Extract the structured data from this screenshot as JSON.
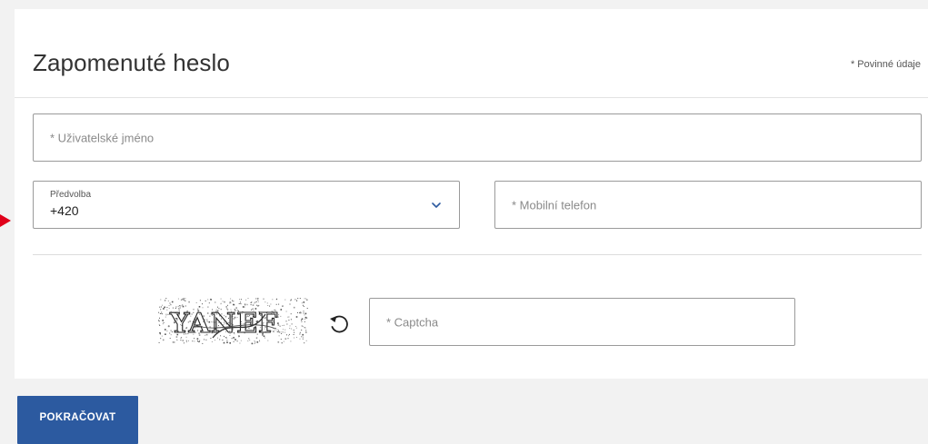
{
  "form": {
    "title": "Zapomenuté heslo",
    "required_note": "* Povinné údaje",
    "username": {
      "placeholder": "* Uživatelské jméno",
      "value": ""
    },
    "prefix": {
      "label": "Předvolba",
      "value": "+420",
      "icon": "chevron-down-icon"
    },
    "mobile": {
      "placeholder": "* Mobilní telefon",
      "value": ""
    },
    "captcha": {
      "image_text": "YANEF",
      "placeholder": "* Captcha",
      "value": "",
      "refresh_icon": "refresh-icon"
    },
    "submit_label": "POKRAČOVAT"
  },
  "colors": {
    "primary": "#2c5aa0",
    "page_background": "#f2f2f2",
    "card_background": "#ffffff",
    "field_border": "#9a9a9a",
    "pointer": "#e0001a"
  }
}
